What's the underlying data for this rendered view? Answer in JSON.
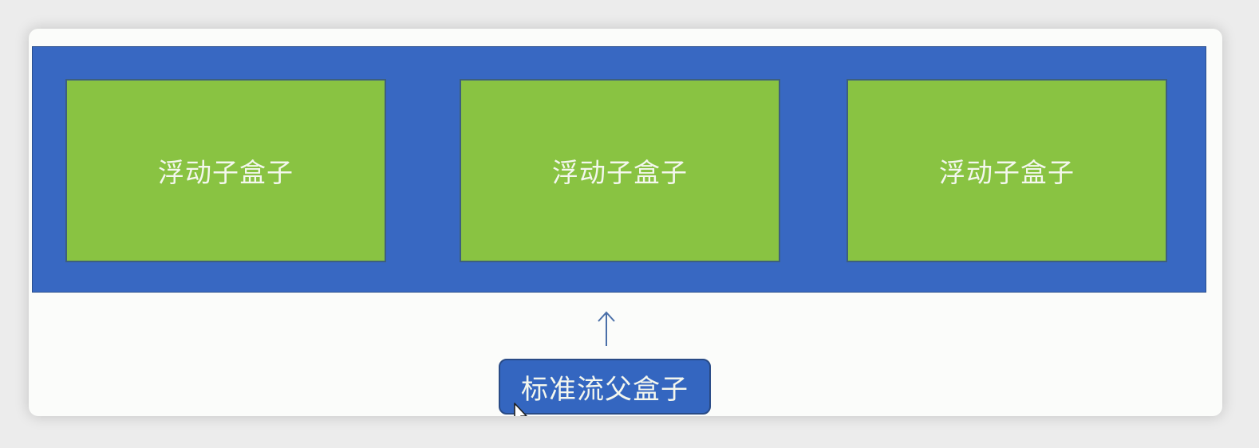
{
  "colors": {
    "parent_fill": "#3868c2",
    "child_fill": "#89c342",
    "text": "#f4f7ee",
    "arrow": "#4a6fa8",
    "label_fill": "#3466c0"
  },
  "diagram": {
    "float_children": [
      {
        "label": "浮动子盒子"
      },
      {
        "label": "浮动子盒子"
      },
      {
        "label": "浮动子盒子"
      }
    ],
    "parent_label": "标准流父盒子",
    "arrow_icon": "arrow-up-icon",
    "cursor_icon": "mouse-cursor-icon"
  }
}
